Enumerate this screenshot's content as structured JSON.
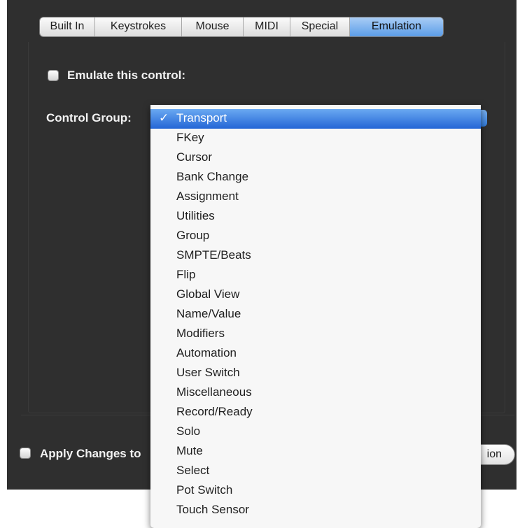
{
  "tabs": [
    {
      "label": "Built In"
    },
    {
      "label": "Keystrokes"
    },
    {
      "label": "Mouse"
    },
    {
      "label": "MIDI"
    },
    {
      "label": "Special"
    },
    {
      "label": "Emulation",
      "active": true
    }
  ],
  "emulate": {
    "label": "Emulate this control:",
    "checked": false
  },
  "control_group": {
    "label": "Control Group:",
    "selected": "Transport",
    "check_glyph": "✓",
    "options": [
      "Transport",
      "FKey",
      "Cursor",
      "Bank Change",
      "Assignment",
      "Utilities",
      "Group",
      "SMPTE/Beats",
      "Flip",
      "Global View",
      "Name/Value",
      "Modifiers",
      "Automation",
      "User Switch",
      "Miscellaneous",
      "Record/Ready",
      "Solo",
      "Mute",
      "Select",
      "Pot Switch",
      "Touch Sensor"
    ]
  },
  "footer": {
    "apply_label": "Apply Changes to",
    "restore_button_visible_text": "ion"
  },
  "colors": {
    "selection": "#2466d6",
    "panel": "#2f2f2f",
    "active_tab": "#5b9de8"
  }
}
